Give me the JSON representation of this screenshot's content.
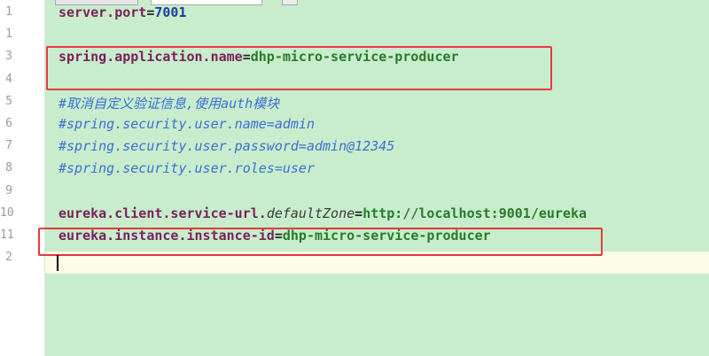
{
  "tabs": [
    "",
    "",
    ""
  ],
  "lines": [
    {
      "n": "1",
      "parts": [
        {
          "t": "server.port",
          "c": "key"
        },
        {
          "t": "=",
          "c": "eq"
        },
        {
          "t": "7001",
          "c": "val"
        }
      ]
    },
    {
      "n": "1",
      "parts": []
    },
    {
      "n": "3",
      "parts": [
        {
          "t": "spring.application.name",
          "c": "key"
        },
        {
          "t": "=",
          "c": "eq"
        },
        {
          "t": "dhp-micro-service-producer",
          "c": "val-green"
        }
      ]
    },
    {
      "n": "4",
      "parts": []
    },
    {
      "n": "5",
      "parts": [
        {
          "t": "#取消自定义验证信息,使用auth模块",
          "c": "comment"
        }
      ]
    },
    {
      "n": "6",
      "parts": [
        {
          "t": "#spring.security.user.name=admin",
          "c": "comment"
        }
      ]
    },
    {
      "n": "7",
      "parts": [
        {
          "t": "#spring.security.user.password=admin@12345",
          "c": "comment"
        }
      ]
    },
    {
      "n": "8",
      "parts": [
        {
          "t": "#spring.security.user.roles=user",
          "c": "comment"
        }
      ]
    },
    {
      "n": "9",
      "parts": []
    },
    {
      "n": "10",
      "parts": [
        {
          "t": "eureka.client.service-url.",
          "c": "key"
        },
        {
          "t": "defaultZone",
          "c": "italic-key"
        },
        {
          "t": "=",
          "c": "eq"
        },
        {
          "t": "http://localhost:9001/eureka",
          "c": "val-green"
        }
      ]
    },
    {
      "n": "11",
      "parts": [
        {
          "t": "eureka.instance.instance-id",
          "c": "key"
        },
        {
          "t": "=",
          "c": "eq"
        },
        {
          "t": "dhp-micro-service-producer",
          "c": "val-green"
        }
      ]
    },
    {
      "n": "2",
      "parts": []
    }
  ],
  "highlights": [
    "application-name-line",
    "instance-id-line"
  ],
  "colors": {
    "editor_background": "#c7edcc",
    "key": "#7b1f5b",
    "value": "#2a7a2a",
    "number": "#1f3c9c",
    "comment": "#3d6fd4",
    "highlight_box": "#e5393d"
  }
}
